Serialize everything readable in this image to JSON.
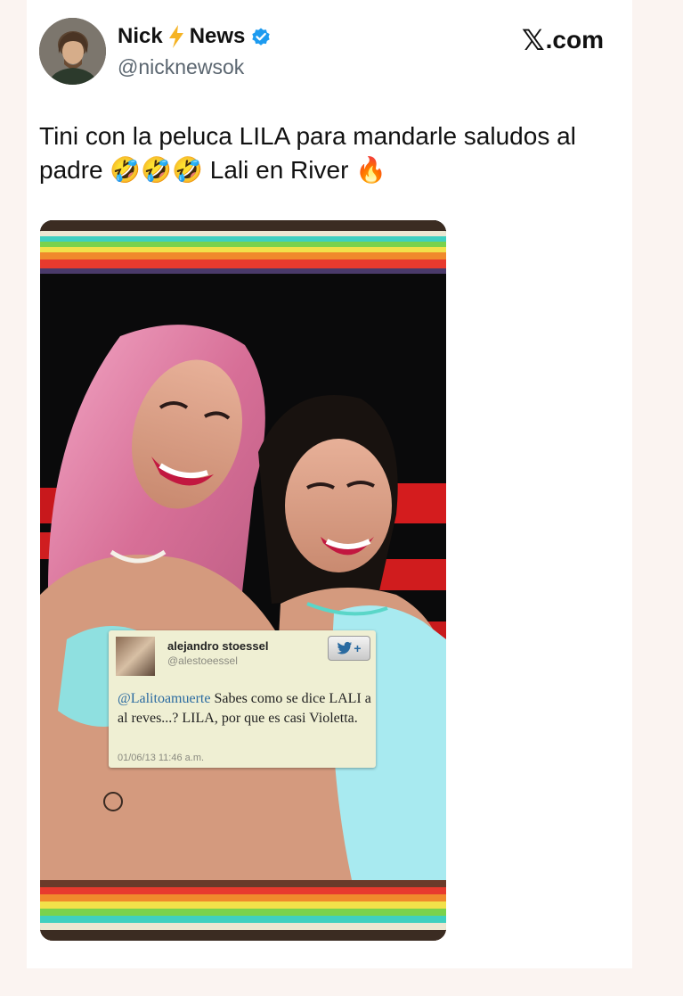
{
  "tweet": {
    "display_name_part1": "Nick",
    "display_name_part2": "News",
    "handle": "@nicknewsok",
    "brand": ".com",
    "brand_icon": "x-logo-icon",
    "text_line1": "Tini con la peluca LILA para mandarle saludos al",
    "text_line2": "padre 🤣🤣🤣 Lali en River 🔥",
    "accent_color": "#1d9bf0"
  },
  "embedded_tweet": {
    "name": "alejandro stoessel",
    "handle": "@alestoeessel",
    "follow_label": "+",
    "mention": "@Lalitoamuerte",
    "text": " Sabes como se dice LALI a al reves...? LILA, por que es casi Violetta.",
    "timestamp": "01/06/13 11:46 a.m."
  }
}
